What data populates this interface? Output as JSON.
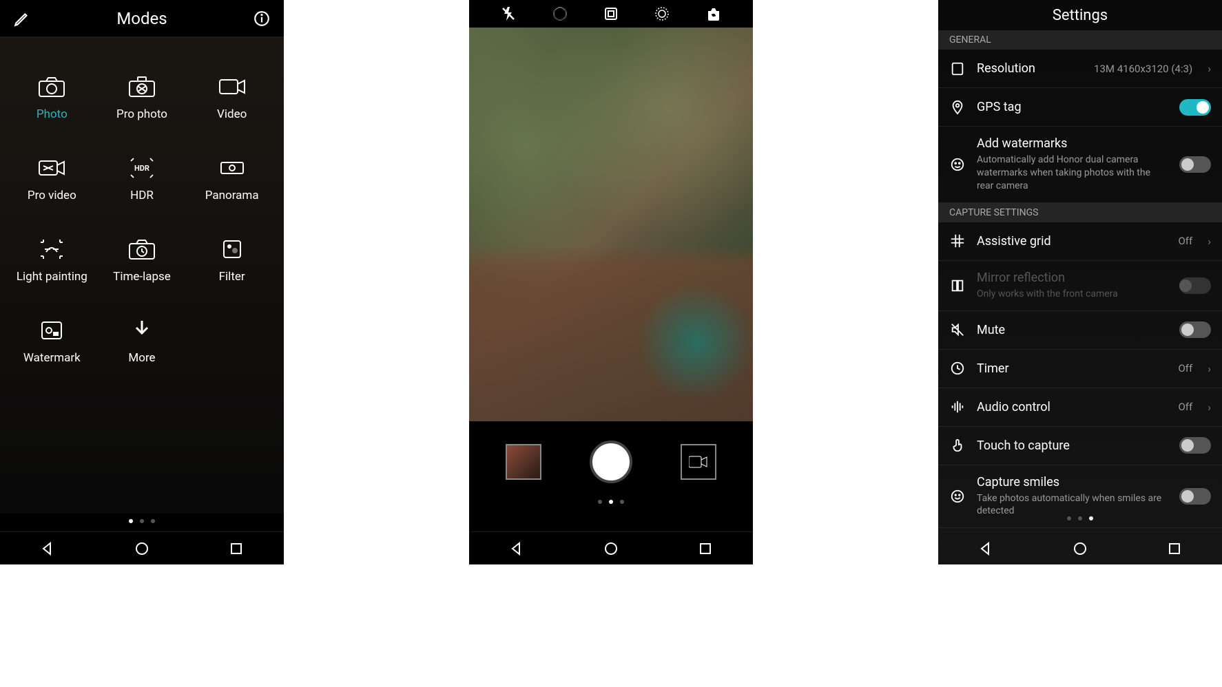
{
  "modes": {
    "title": "Modes",
    "items": [
      {
        "label": "Photo",
        "active": true
      },
      {
        "label": "Pro photo"
      },
      {
        "label": "Video"
      },
      {
        "label": "Pro video"
      },
      {
        "label": "HDR"
      },
      {
        "label": "Panorama"
      },
      {
        "label": "Light painting"
      },
      {
        "label": "Time-lapse"
      },
      {
        "label": "Filter"
      },
      {
        "label": "Watermark"
      },
      {
        "label": "More"
      }
    ]
  },
  "settings": {
    "title": "Settings",
    "sections": {
      "general": "GENERAL",
      "capture": "CAPTURE SETTINGS"
    },
    "items": {
      "resolution": {
        "title": "Resolution",
        "value": "13M 4160x3120 (4:3)"
      },
      "gps": {
        "title": "GPS tag",
        "on": true
      },
      "watermarks": {
        "title": "Add watermarks",
        "sub": "Automatically add Honor dual camera watermarks when taking photos with the rear camera",
        "on": false
      },
      "grid": {
        "title": "Assistive grid",
        "value": "Off"
      },
      "mirror": {
        "title": "Mirror reflection",
        "sub": "Only works with the front camera"
      },
      "mute": {
        "title": "Mute",
        "on": false
      },
      "timer": {
        "title": "Timer",
        "value": "Off"
      },
      "audio": {
        "title": "Audio control",
        "value": "Off"
      },
      "touch": {
        "title": "Touch to capture",
        "on": false
      },
      "smiles": {
        "title": "Capture smiles",
        "sub": "Take photos automatically when smiles are detected",
        "on": false
      }
    }
  }
}
